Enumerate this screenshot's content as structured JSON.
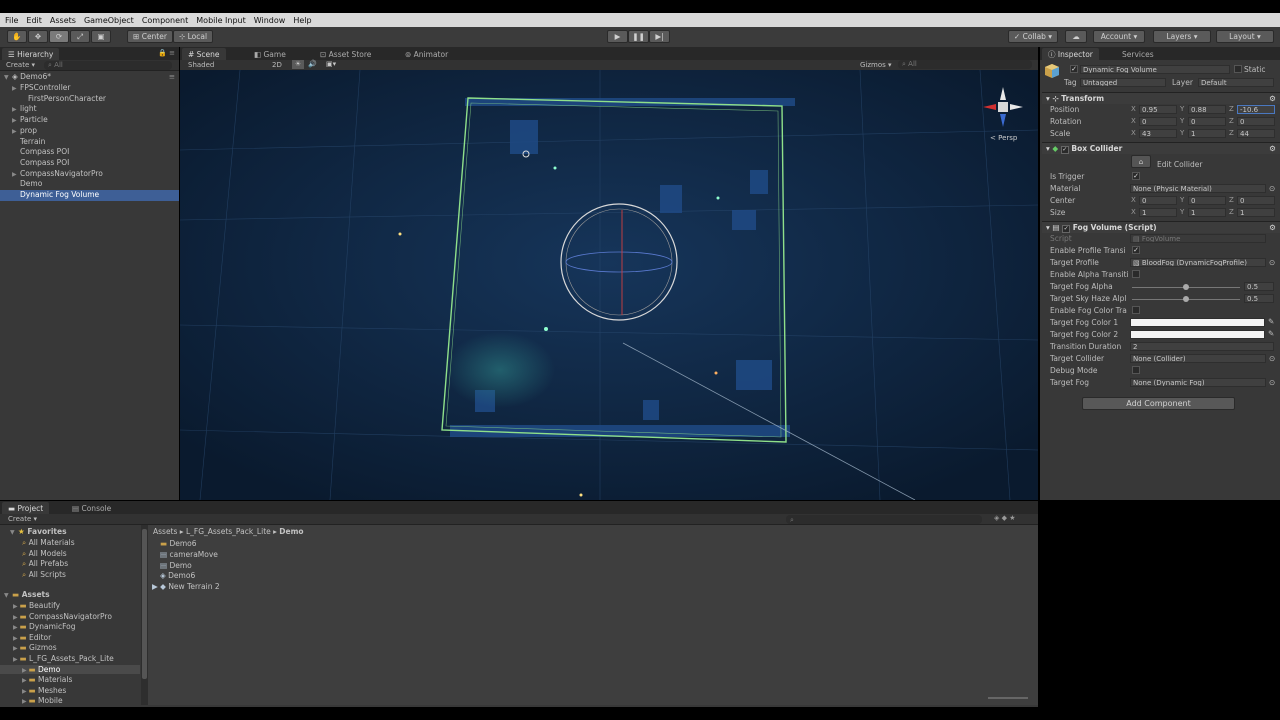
{
  "menu": [
    "File",
    "Edit",
    "Assets",
    "GameObject",
    "Component",
    "Mobile Input",
    "Window",
    "Help"
  ],
  "toolbar": {
    "pivot": "Center",
    "space": "Local",
    "collab": "Collab ▾",
    "account": "Account",
    "layers": "Layers",
    "layout": "Layout"
  },
  "hierarchy": {
    "tab": "Hierarchy",
    "create": "Create ▾",
    "search": "All",
    "scene": "Demo6*",
    "items": [
      {
        "label": "FPSController",
        "indent": 1,
        "arrow": true
      },
      {
        "label": "FirstPersonCharacter",
        "indent": 2,
        "arrow": false
      },
      {
        "label": "light",
        "indent": 1,
        "arrow": true
      },
      {
        "label": "Particle",
        "indent": 1,
        "arrow": true
      },
      {
        "label": "prop",
        "indent": 1,
        "arrow": true
      },
      {
        "label": "Terrain",
        "indent": 1,
        "arrow": false
      },
      {
        "label": "Compass POI",
        "indent": 1,
        "arrow": false
      },
      {
        "label": "Compass POI",
        "indent": 1,
        "arrow": false
      },
      {
        "label": "CompassNavigatorPro",
        "indent": 1,
        "arrow": true
      },
      {
        "label": "Demo",
        "indent": 1,
        "arrow": false
      },
      {
        "label": "Dynamic Fog Volume",
        "indent": 1,
        "arrow": false,
        "selected": true
      }
    ]
  },
  "scene_tabs": [
    "Scene",
    "Game",
    "Asset Store",
    "Animator"
  ],
  "scene_bar": {
    "shading": "Shaded",
    "mode2d": "2D",
    "gizmos": "Gizmos ▾",
    "search": "All"
  },
  "gizmo_label": "Persp",
  "inspector": {
    "tabs": [
      "Inspector",
      "Services"
    ],
    "object_name": "Dynamic Fog Volume",
    "static": "Static",
    "tag_label": "Tag",
    "tag_value": "Untagged",
    "layer_label": "Layer",
    "layer_value": "Default",
    "transform": {
      "title": "Transform",
      "position_label": "Position",
      "position": [
        "0.95",
        "0.88",
        "-10.6"
      ],
      "rotation_label": "Rotation",
      "rotation": [
        "0",
        "0",
        "0"
      ],
      "scale_label": "Scale",
      "scale": [
        "43",
        "1",
        "44"
      ]
    },
    "box_collider": {
      "title": "Box Collider",
      "edit": "Edit Collider",
      "is_trigger": "Is Trigger",
      "material_label": "Material",
      "material": "None (Physic Material)",
      "center_label": "Center",
      "center": [
        "0",
        "0",
        "0"
      ],
      "size_label": "Size",
      "size": [
        "1",
        "1",
        "1"
      ]
    },
    "fog_volume": {
      "title": "Fog Volume (Script)",
      "script_label": "Script",
      "script": "FogVolume",
      "enable_profile": "Enable Profile Transi",
      "target_profile_label": "Target Profile",
      "target_profile": "BloodFog (DynamicFogProfile)",
      "enable_alpha": "Enable Alpha Transiti",
      "fog_alpha_label": "Target Fog Alpha",
      "fog_alpha": "0.5",
      "sky_haze_label": "Target Sky Haze Alpl",
      "sky_haze": "0.5",
      "enable_color": "Enable Fog Color Tra",
      "color1_label": "Target Fog Color 1",
      "color2_label": "Target Fog Color 2",
      "duration_label": "Transition Duration",
      "duration": "2",
      "collider_label": "Target Collider",
      "collider": "None (Collider)",
      "debug_label": "Debug Mode",
      "target_fog_label": "Target Fog",
      "target_fog": "None (Dynamic Fog)"
    },
    "add_component": "Add Component"
  },
  "project": {
    "tabs": [
      "Project",
      "Console"
    ],
    "create": "Create ▾",
    "favorites_title": "Favorites",
    "favorites": [
      "All Materials",
      "All Models",
      "All Prefabs",
      "All Scripts"
    ],
    "assets_title": "Assets",
    "folders": [
      {
        "label": "Beautify",
        "indent": 1
      },
      {
        "label": "CompassNavigatorPro",
        "indent": 1
      },
      {
        "label": "DynamicFog",
        "indent": 1
      },
      {
        "label": "Editor",
        "indent": 1
      },
      {
        "label": "Gizmos",
        "indent": 1
      },
      {
        "label": "L_FG_Assets_Pack_Lite",
        "indent": 1
      },
      {
        "label": "Demo",
        "indent": 2,
        "selected": true
      },
      {
        "label": "Materials",
        "indent": 2
      },
      {
        "label": "Meshes",
        "indent": 2
      },
      {
        "label": "Mobile",
        "indent": 2
      }
    ],
    "breadcrumb": [
      "Assets",
      "L_FG_Assets_Pack_Lite",
      "Demo"
    ],
    "files": [
      "Demo6",
      "cameraMove",
      "Demo",
      "Demo6",
      "New Terrain 2"
    ]
  },
  "colors": {
    "selection": "#3e5f96",
    "panel": "#383838",
    "scene_bg": "#0c2038",
    "collider": "#8fe08a"
  }
}
